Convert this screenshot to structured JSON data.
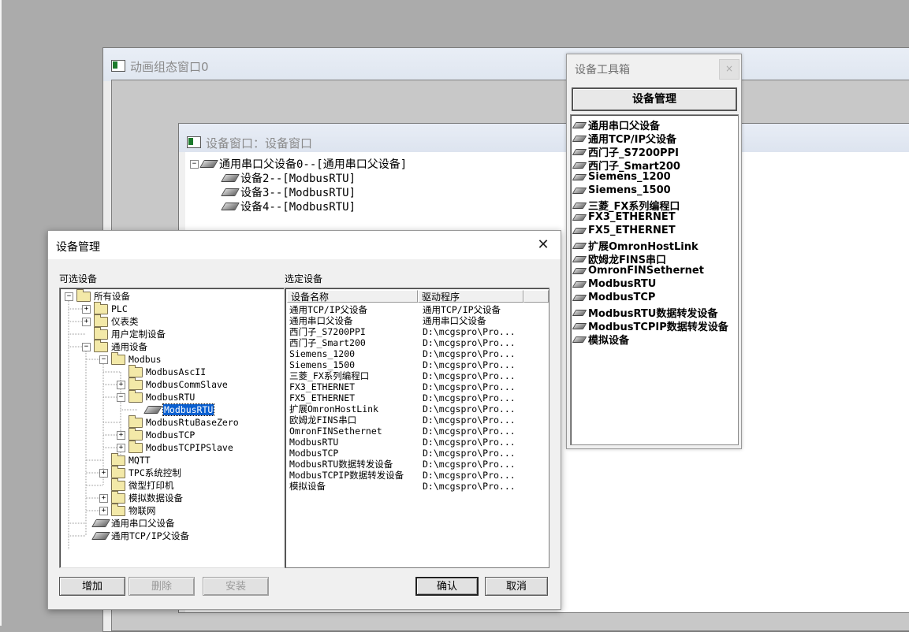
{
  "colors": {
    "desktop": "#ababab",
    "selection": "#0a5fd0"
  },
  "anim_window": {
    "title": "动画组态窗口0"
  },
  "device_window": {
    "title": "设备窗口：设备窗口",
    "tree": [
      {
        "label": "通用串口父设备0--[通用串口父设备]",
        "expanded": true
      },
      {
        "label": "设备2--[ModbusRTU]"
      },
      {
        "label": "设备3--[ModbusRTU]"
      },
      {
        "label": "设备4--[ModbusRTU]"
      }
    ]
  },
  "toolbox": {
    "title": "设备工具箱",
    "close": "×",
    "manage_button": "设备管理",
    "items": [
      "通用串口父设备",
      "通用TCP/IP父设备",
      "西门子_S7200PPI",
      "西门子_Smart200",
      "Siemens_1200",
      "Siemens_1500",
      "三菱_FX系列编程口",
      "FX3_ETHERNET",
      "FX5_ETHERNET",
      "扩展OmronHostLink",
      "欧姆龙FINS串口",
      "OmronFINSethernet",
      "ModbusRTU",
      "ModbusTCP",
      "ModbusRTU数据转发设备",
      "ModbusTCPIP数据转发设备",
      "模拟设备"
    ]
  },
  "dialog": {
    "title": "设备管理",
    "close": "✕",
    "available_label": "可选设备",
    "selected_label": "选定设备",
    "tree": [
      {
        "label": "所有设备",
        "exp": "−",
        "kind": "folder"
      },
      {
        "label": "PLC",
        "exp": "+",
        "kind": "folder"
      },
      {
        "label": "仪表类",
        "exp": "+",
        "kind": "folder"
      },
      {
        "label": "用户定制设备",
        "exp": "",
        "kind": "folder"
      },
      {
        "label": "通用设备",
        "exp": "−",
        "kind": "folder"
      },
      {
        "label": "Modbus",
        "exp": "−",
        "kind": "folder"
      },
      {
        "label": "ModbusAscII",
        "exp": "",
        "kind": "folder"
      },
      {
        "label": "ModbusCommSlave",
        "exp": "+",
        "kind": "folder"
      },
      {
        "label": "ModbusRTU",
        "exp": "−",
        "kind": "folder"
      },
      {
        "label": "ModbusRTU",
        "exp": "",
        "kind": "chip",
        "selected": true
      },
      {
        "label": "ModbusRtuBaseZero",
        "exp": "",
        "kind": "folder"
      },
      {
        "label": "ModbusTCP",
        "exp": "+",
        "kind": "folder"
      },
      {
        "label": "ModbusTCPIPSlave",
        "exp": "+",
        "kind": "folder"
      },
      {
        "label": "MQTT",
        "exp": "",
        "kind": "folder"
      },
      {
        "label": "TPC系统控制",
        "exp": "+",
        "kind": "folder"
      },
      {
        "label": "微型打印机",
        "exp": "",
        "kind": "folder"
      },
      {
        "label": "模拟数据设备",
        "exp": "+",
        "kind": "folder"
      },
      {
        "label": "物联网",
        "exp": "+",
        "kind": "folder"
      },
      {
        "label": "通用串口父设备",
        "exp": "",
        "kind": "chip"
      },
      {
        "label": "通用TCP/IP父设备",
        "exp": "",
        "kind": "chip"
      }
    ],
    "columns": [
      "设备名称",
      "驱动程序"
    ],
    "rows": [
      [
        "通用TCP/IP父设备",
        "通用TCP/IP父设备"
      ],
      [
        "通用串口父设备",
        "通用串口父设备"
      ],
      [
        "西门子_S7200PPI",
        "D:\\mcgspro\\Pro..."
      ],
      [
        "西门子_Smart200",
        "D:\\mcgspro\\Pro..."
      ],
      [
        "Siemens_1200",
        "D:\\mcgspro\\Pro..."
      ],
      [
        "Siemens_1500",
        "D:\\mcgspro\\Pro..."
      ],
      [
        "三菱_FX系列编程口",
        "D:\\mcgspro\\Pro..."
      ],
      [
        "FX3_ETHERNET",
        "D:\\mcgspro\\Pro..."
      ],
      [
        "FX5_ETHERNET",
        "D:\\mcgspro\\Pro..."
      ],
      [
        "扩展OmronHostLink",
        "D:\\mcgspro\\Pro..."
      ],
      [
        "欧姆龙FINS串口",
        "D:\\mcgspro\\Pro..."
      ],
      [
        "OmronFINSethernet",
        "D:\\mcgspro\\Pro..."
      ],
      [
        "ModbusRTU",
        "D:\\mcgspro\\Pro..."
      ],
      [
        "ModbusTCP",
        "D:\\mcgspro\\Pro..."
      ],
      [
        "ModbusRTU数据转发设备",
        "D:\\mcgspro\\Pro..."
      ],
      [
        "ModbusTCPIP数据转发设备",
        "D:\\mcgspro\\Pro..."
      ],
      [
        "模拟设备",
        "D:\\mcgspro\\Pro..."
      ]
    ],
    "buttons": {
      "add": "增加",
      "delete": "删除",
      "install": "安装",
      "ok": "确认",
      "cancel": "取消"
    }
  }
}
